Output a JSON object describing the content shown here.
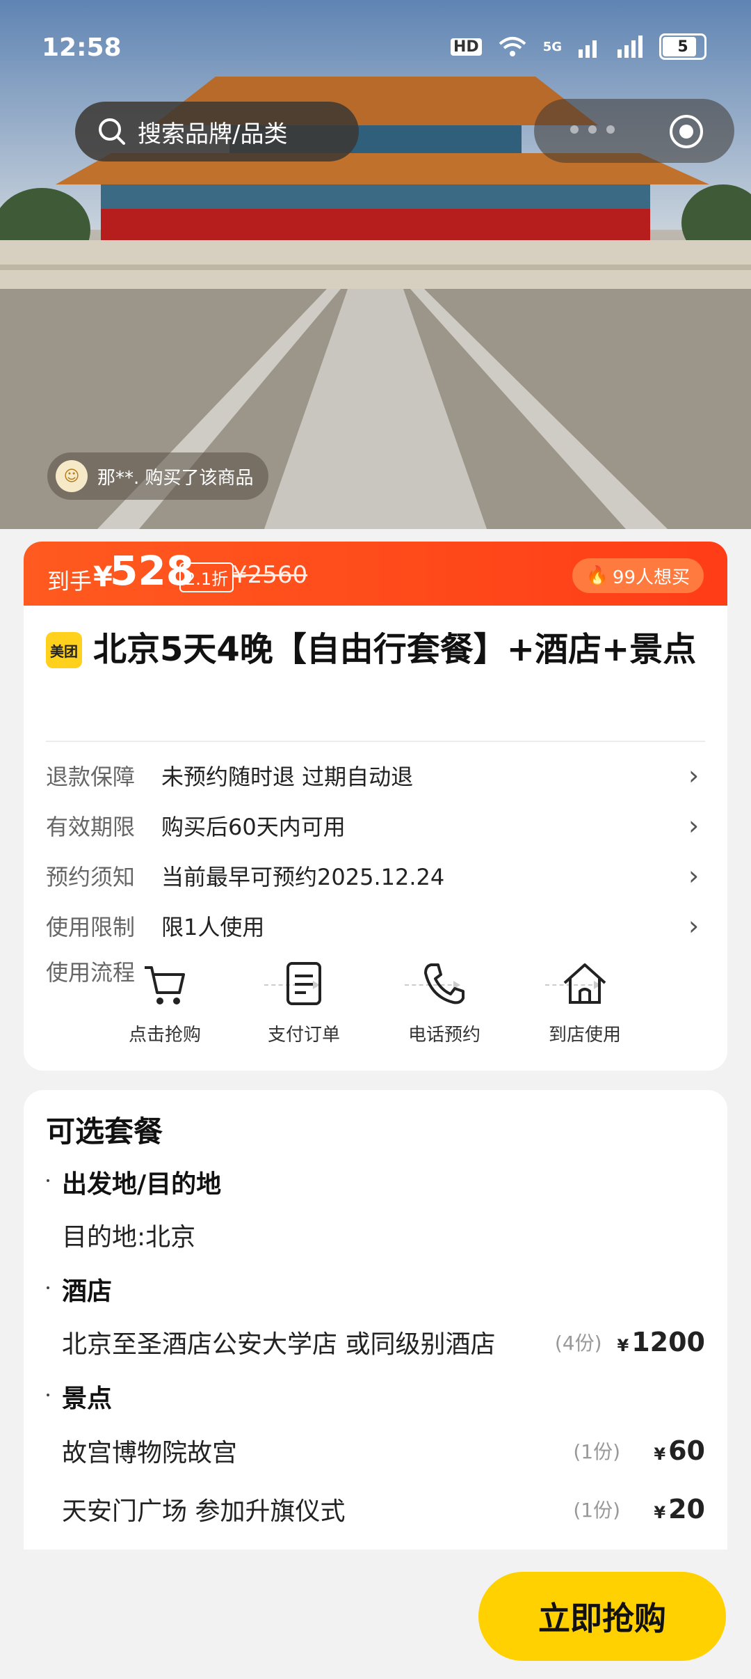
{
  "status_bar": {
    "time": "12:58",
    "network": "5G",
    "battery": "5"
  },
  "search": {
    "placeholder": "搜索品牌/品类"
  },
  "buyer_ticker": {
    "text": "那**. 购买了该商品"
  },
  "price": {
    "label": "到手",
    "currency": "¥",
    "amount": "528",
    "discount": "2.1折",
    "original": "¥2560",
    "wants": "99人想买"
  },
  "product": {
    "brand_badge": "美团",
    "title": "北京5天4晚【自由行套餐】+酒店+景点"
  },
  "details": [
    {
      "key": "退款保障",
      "value": "未预约随时退 过期自动退"
    },
    {
      "key": "有效期限",
      "value": "购买后60天内可用"
    },
    {
      "key": "预约须知",
      "value": "当前最早可预约2025.12.24"
    },
    {
      "key": "使用限制",
      "value": "限1人使用"
    }
  ],
  "flow": {
    "label": "使用流程",
    "steps": [
      "点击抢购",
      "支付订单",
      "电话预约",
      "到店使用"
    ]
  },
  "packages": {
    "title": "可选套餐",
    "sections": [
      {
        "name": "出发地/目的地",
        "items": [
          {
            "name": "目的地:北京"
          }
        ]
      },
      {
        "name": "酒店",
        "items": [
          {
            "name": "北京至圣酒店公安大学店 或同级别酒店",
            "qty": "(4份)",
            "currency": "¥",
            "price": "1200"
          }
        ]
      },
      {
        "name": "景点",
        "items": [
          {
            "name": "故宫博物院故宫",
            "qty": "(1份)",
            "currency": "¥",
            "price": "60"
          },
          {
            "name": "天安门广场 参加升旗仪式",
            "qty": "(1份)",
            "currency": "¥",
            "price": "20"
          }
        ]
      }
    ]
  },
  "buy_button": {
    "label": "立即抢购"
  },
  "colors": {
    "accent_orange": "#ff4b1a",
    "button_yellow": "#ffd100",
    "brand_yellow": "#ffd11c"
  }
}
